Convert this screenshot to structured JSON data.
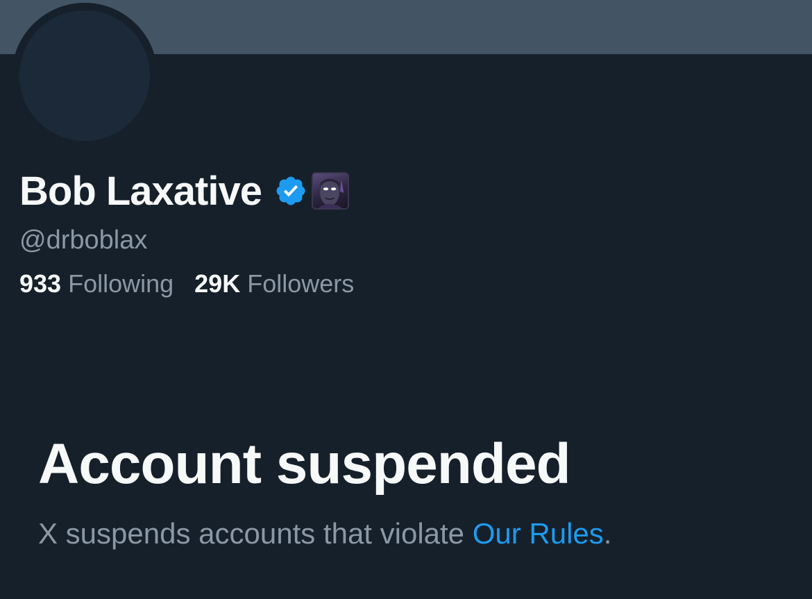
{
  "profile": {
    "display_name": "Bob Laxative",
    "handle": "@drboblax",
    "verified_icon": "verified-badge-icon",
    "affiliate_badge": "affiliate-avatar-badge"
  },
  "stats": {
    "following_count": "933",
    "following_label": "Following",
    "followers_count": "29K",
    "followers_label": "Followers"
  },
  "suspension": {
    "title": "Account suspended",
    "message_prefix": "X suspends accounts that violate ",
    "link_text": "Our Rules",
    "message_suffix": "."
  },
  "colors": {
    "background": "#16202A",
    "banner": "#435465",
    "text_primary": "#F7F9F9",
    "text_secondary": "#8B98A5",
    "accent": "#1D9BF0"
  }
}
